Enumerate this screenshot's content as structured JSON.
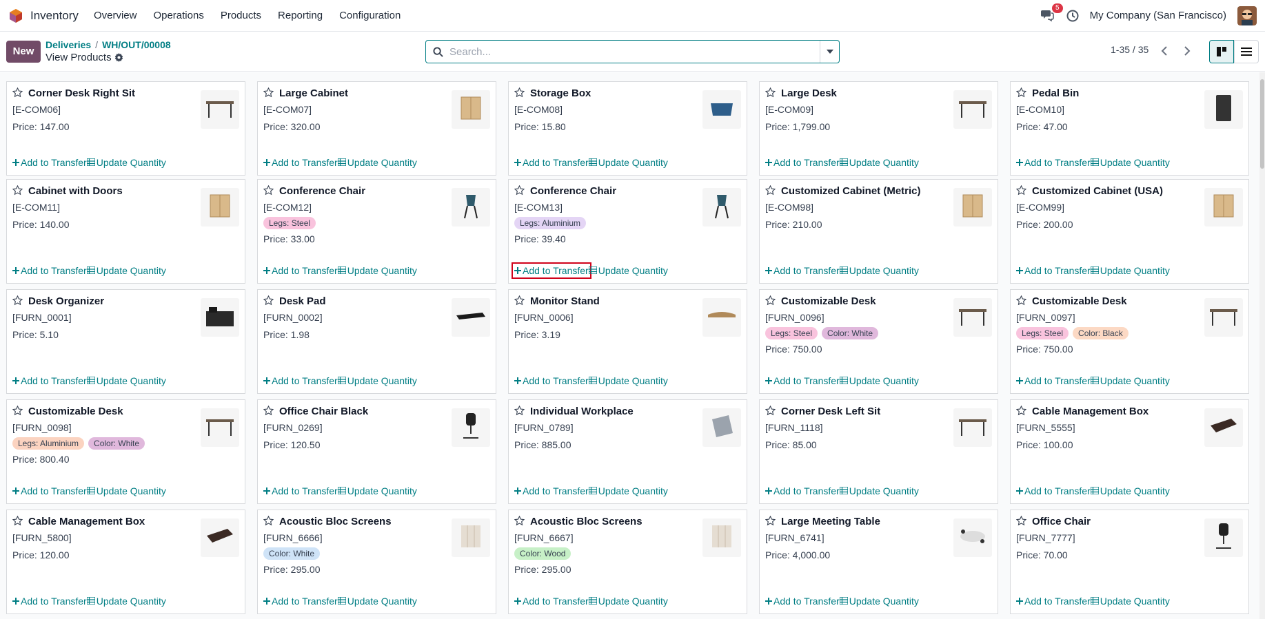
{
  "app": {
    "name": "Inventory"
  },
  "menu": [
    "Overview",
    "Operations",
    "Products",
    "Reporting",
    "Configuration"
  ],
  "notifications": {
    "count": "5"
  },
  "company": "My Company (San Francisco)",
  "toolbar": {
    "new_label": "New"
  },
  "breadcrumb": {
    "parent": "Deliveries",
    "record": "WH/OUT/00008",
    "separator": "/"
  },
  "view_title": "View Products",
  "search": {
    "placeholder": "Search..."
  },
  "pager": {
    "range": "1-35 / 35"
  },
  "card_actions": {
    "add": "Add to Transfer",
    "update": "Update Quantity"
  },
  "colors": {
    "accent": "#017e84",
    "primary": "#714b67",
    "tag_steel": "#f9c3dd",
    "tag_aluminium": "#e4d5f5",
    "tag_white_purple": "#e0b8dc",
    "tag_white_blue": "#cfe3f7",
    "tag_wood": "#c7f0c7",
    "tag_black": "#fcd9c4",
    "tag_aluminium_orange": "#fbd3c0"
  },
  "products": [
    {
      "name": "Corner Desk Right Sit",
      "code": "[E-COM06]",
      "price": "Price: 147.00",
      "tags": [],
      "icon": "desk-icon"
    },
    {
      "name": "Large Cabinet",
      "code": "[E-COM07]",
      "price": "Price: 320.00",
      "tags": [],
      "icon": "cabinet-icon"
    },
    {
      "name": "Storage Box",
      "code": "[E-COM08]",
      "price": "Price: 15.80",
      "tags": [],
      "icon": "box-icon"
    },
    {
      "name": "Large Desk",
      "code": "[E-COM09]",
      "price": "Price: 1,799.00",
      "tags": [],
      "icon": "desk-icon"
    },
    {
      "name": "Pedal Bin",
      "code": "[E-COM10]",
      "price": "Price: 47.00",
      "tags": [],
      "icon": "bin-icon"
    },
    {
      "name": "Cabinet with Doors",
      "code": "[E-COM11]",
      "price": "Price: 140.00",
      "tags": [],
      "icon": "cabinet-icon"
    },
    {
      "name": "Conference Chair",
      "code": "[E-COM12]",
      "price": "Price: 33.00",
      "tags": [
        {
          "label": "Legs: Steel",
          "color": "#f9c3dd"
        }
      ],
      "icon": "chair-icon"
    },
    {
      "name": "Conference Chair",
      "code": "[E-COM13]",
      "price": "Price: 39.40",
      "tags": [
        {
          "label": "Legs: Aluminium",
          "color": "#e4d5f5"
        }
      ],
      "icon": "chair-icon"
    },
    {
      "name": "Customized Cabinet (Metric)",
      "code": "[E-COM98]",
      "price": "Price: 210.00",
      "tags": [],
      "icon": "cabinet-icon"
    },
    {
      "name": "Customized Cabinet (USA)",
      "code": "[E-COM99]",
      "price": "Price: 200.00",
      "tags": [],
      "icon": "cabinet-icon"
    },
    {
      "name": "Desk Organizer",
      "code": "[FURN_0001]",
      "price": "Price: 5.10",
      "tags": [],
      "icon": "organizer-icon"
    },
    {
      "name": "Desk Pad",
      "code": "[FURN_0002]",
      "price": "Price: 1.98",
      "tags": [],
      "icon": "pad-icon"
    },
    {
      "name": "Monitor Stand",
      "code": "[FURN_0006]",
      "price": "Price: 3.19",
      "tags": [],
      "icon": "stand-icon"
    },
    {
      "name": "Customizable Desk",
      "code": "[FURN_0096]",
      "price": "Price: 750.00",
      "tags": [
        {
          "label": "Legs: Steel",
          "color": "#f9c3dd"
        },
        {
          "label": "Color: White",
          "color": "#e0b8dc"
        }
      ],
      "icon": "desk-icon"
    },
    {
      "name": "Customizable Desk",
      "code": "[FURN_0097]",
      "price": "Price: 750.00",
      "tags": [
        {
          "label": "Legs: Steel",
          "color": "#f9c3dd"
        },
        {
          "label": "Color: Black",
          "color": "#fcd9c4"
        }
      ],
      "icon": "desk-icon"
    },
    {
      "name": "Customizable Desk",
      "code": "[FURN_0098]",
      "price": "Price: 800.40",
      "tags": [
        {
          "label": "Legs: Aluminium",
          "color": "#fbd3c0"
        },
        {
          "label": "Color: White",
          "color": "#e0b8dc"
        }
      ],
      "icon": "desk-icon"
    },
    {
      "name": "Office Chair Black",
      "code": "[FURN_0269]",
      "price": "Price: 120.50",
      "tags": [],
      "icon": "office-chair-icon"
    },
    {
      "name": "Individual Workplace",
      "code": "[FURN_0789]",
      "price": "Price: 885.00",
      "tags": [],
      "icon": "workplace-icon"
    },
    {
      "name": "Corner Desk Left Sit",
      "code": "[FURN_1118]",
      "price": "Price: 85.00",
      "tags": [],
      "icon": "desk-icon"
    },
    {
      "name": "Cable Management Box",
      "code": "[FURN_5555]",
      "price": "Price: 100.00",
      "tags": [],
      "icon": "cable-box-icon"
    },
    {
      "name": "Cable Management Box",
      "code": "[FURN_5800]",
      "price": "Price: 120.00",
      "tags": [],
      "icon": "cable-box-icon"
    },
    {
      "name": "Acoustic Bloc Screens",
      "code": "[FURN_6666]",
      "price": "Price: 295.00",
      "tags": [
        {
          "label": "Color: White",
          "color": "#cfe3f7"
        }
      ],
      "icon": "screen-icon"
    },
    {
      "name": "Acoustic Bloc Screens",
      "code": "[FURN_6667]",
      "price": "Price: 295.00",
      "tags": [
        {
          "label": "Color: Wood",
          "color": "#c7f0c7"
        }
      ],
      "icon": "screen-icon"
    },
    {
      "name": "Large Meeting Table",
      "code": "[FURN_6741]",
      "price": "Price: 4,000.00",
      "tags": [],
      "icon": "table-icon"
    },
    {
      "name": "Office Chair",
      "code": "[FURN_7777]",
      "price": "Price: 70.00",
      "tags": [],
      "icon": "office-chair-icon"
    }
  ]
}
